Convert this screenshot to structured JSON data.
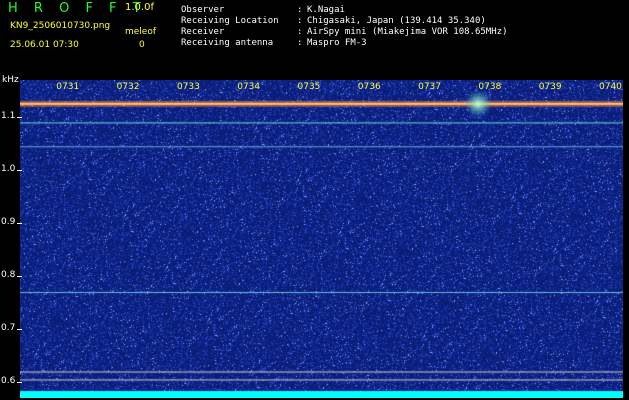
{
  "header": {
    "brand": "H R O F F T",
    "version": "1.0.0f",
    "filename": "KN9_2506010730.png",
    "meteor_label": "meleof",
    "datetime": "25.06.01 07:30",
    "count": "0",
    "info": [
      {
        "key": "Observer",
        "value": "K.Nagai"
      },
      {
        "key": "Receiving Location",
        "value": "Chigasaki, Japan (139.414 35.340)"
      },
      {
        "key": "Receiver",
        "value": "AirSpy mini (Miakejima VOR 108.65MHz)"
      },
      {
        "key": "Receiving antenna",
        "value": "Maspro FM-3"
      }
    ]
  },
  "chart_data": {
    "type": "heatmap",
    "ylabel": "kHz",
    "ylim": [
      0.57,
      1.17
    ],
    "yticks": [
      0.6,
      0.7,
      0.8,
      0.9,
      1.0,
      1.1
    ],
    "ytick_labels": [
      "0.6",
      "0.7",
      "0.8",
      "0.9",
      "1.0",
      "1.1"
    ],
    "x_ticks": [
      "0731",
      "0732",
      "0733",
      "0734",
      "0735",
      "0736",
      "0737",
      "0738",
      "0739",
      "0740"
    ],
    "xlim": [
      0,
      10
    ],
    "x_tick_values": [
      1,
      2,
      3,
      4,
      5,
      6,
      7,
      8,
      9,
      10
    ],
    "horizontal_lines_khz": [
      {
        "freq": 1.125,
        "color": "#ff7733"
      },
      {
        "freq": 1.09,
        "color": "#66dddd"
      },
      {
        "freq": 1.045,
        "color": "#66aadd"
      },
      {
        "freq": 0.77,
        "color": "#66bbdd"
      },
      {
        "freq": 0.62,
        "color": "#cccccc"
      },
      {
        "freq": 0.605,
        "color": "#cccccc"
      }
    ],
    "bright_spot": {
      "time": 7.6,
      "freq": 1.125
    },
    "colors": {
      "background": "#0a1f7a",
      "noise": "#4a6fff",
      "baseline": "#00ffff"
    }
  }
}
